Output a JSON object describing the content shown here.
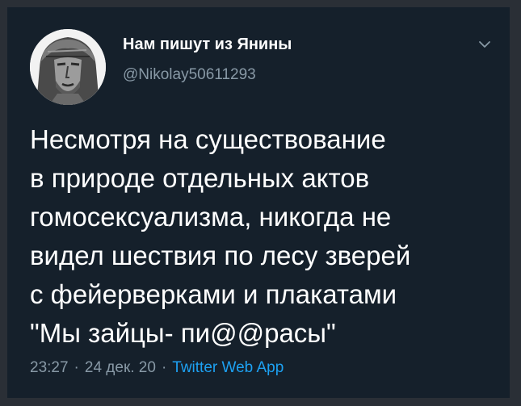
{
  "tweet": {
    "author": {
      "display_name": "Нам пишут из Янины",
      "handle": "@Nikolay50611293",
      "avatar_icon": "user-avatar-statue"
    },
    "menu_icon": "chevron-down-icon",
    "text": "Несмотря на существование\nв природе отдельных актов\nгомосексуализма, никогда не\nвидел шествия по лесу зверей\nс фейерверками и плакатами\n\"Мы зайцы- пи@@расы\"",
    "time": "23:27",
    "date": "24 дек. 20",
    "separator": "·",
    "source": "Twitter Web App"
  },
  "colors": {
    "background": "#15202b",
    "frame": "#2a2f36",
    "text_primary": "#ffffff",
    "text_secondary": "#8899a6",
    "link": "#1da1f2"
  }
}
